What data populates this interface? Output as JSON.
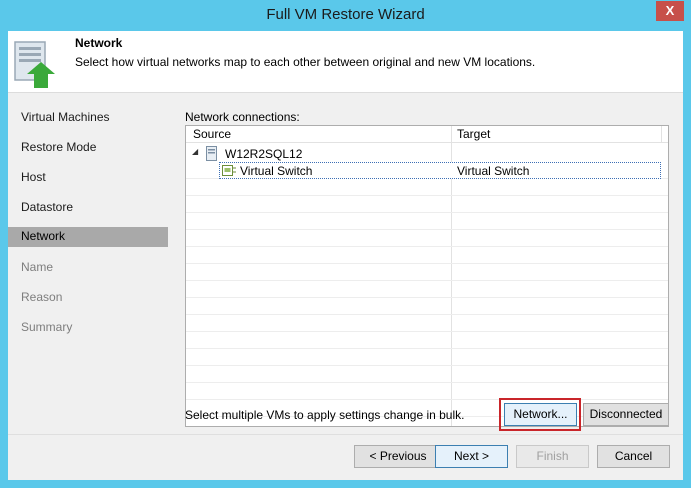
{
  "window": {
    "title": "Full VM Restore Wizard",
    "close_glyph": "X"
  },
  "header": {
    "title": "Network",
    "description": "Select how virtual networks map to each other between original and new VM locations.",
    "icon": "server-upload-arrow-icon"
  },
  "sidebar": {
    "items": [
      {
        "label": "Virtual Machines",
        "state": "done"
      },
      {
        "label": "Restore Mode",
        "state": "done"
      },
      {
        "label": "Host",
        "state": "done"
      },
      {
        "label": "Datastore",
        "state": "done"
      },
      {
        "label": "Network",
        "state": "active"
      },
      {
        "label": "Name",
        "state": "pending"
      },
      {
        "label": "Reason",
        "state": "pending"
      },
      {
        "label": "Summary",
        "state": "pending"
      }
    ]
  },
  "main": {
    "connections_label": "Network connections:",
    "columns": [
      "Source",
      "Target"
    ],
    "tree": {
      "vm": {
        "expander": "◢",
        "name": "W12R2SQL12",
        "icon": "vm-server-icon"
      },
      "networks": [
        {
          "source": "Virtual Switch",
          "target": "Virtual Switch",
          "icon": "network-switch-icon"
        }
      ]
    },
    "bulk_hint": "Select multiple VMs to apply settings change in bulk.",
    "network_button": "Network...",
    "disconnected_button": "Disconnected"
  },
  "footer": {
    "previous": "< Previous",
    "next": "Next >",
    "finish": "Finish",
    "cancel": "Cancel"
  },
  "colors": {
    "titlebar": "#5ac8ea",
    "active_step": "#a9a9a9",
    "highlight": "#c9252a"
  }
}
